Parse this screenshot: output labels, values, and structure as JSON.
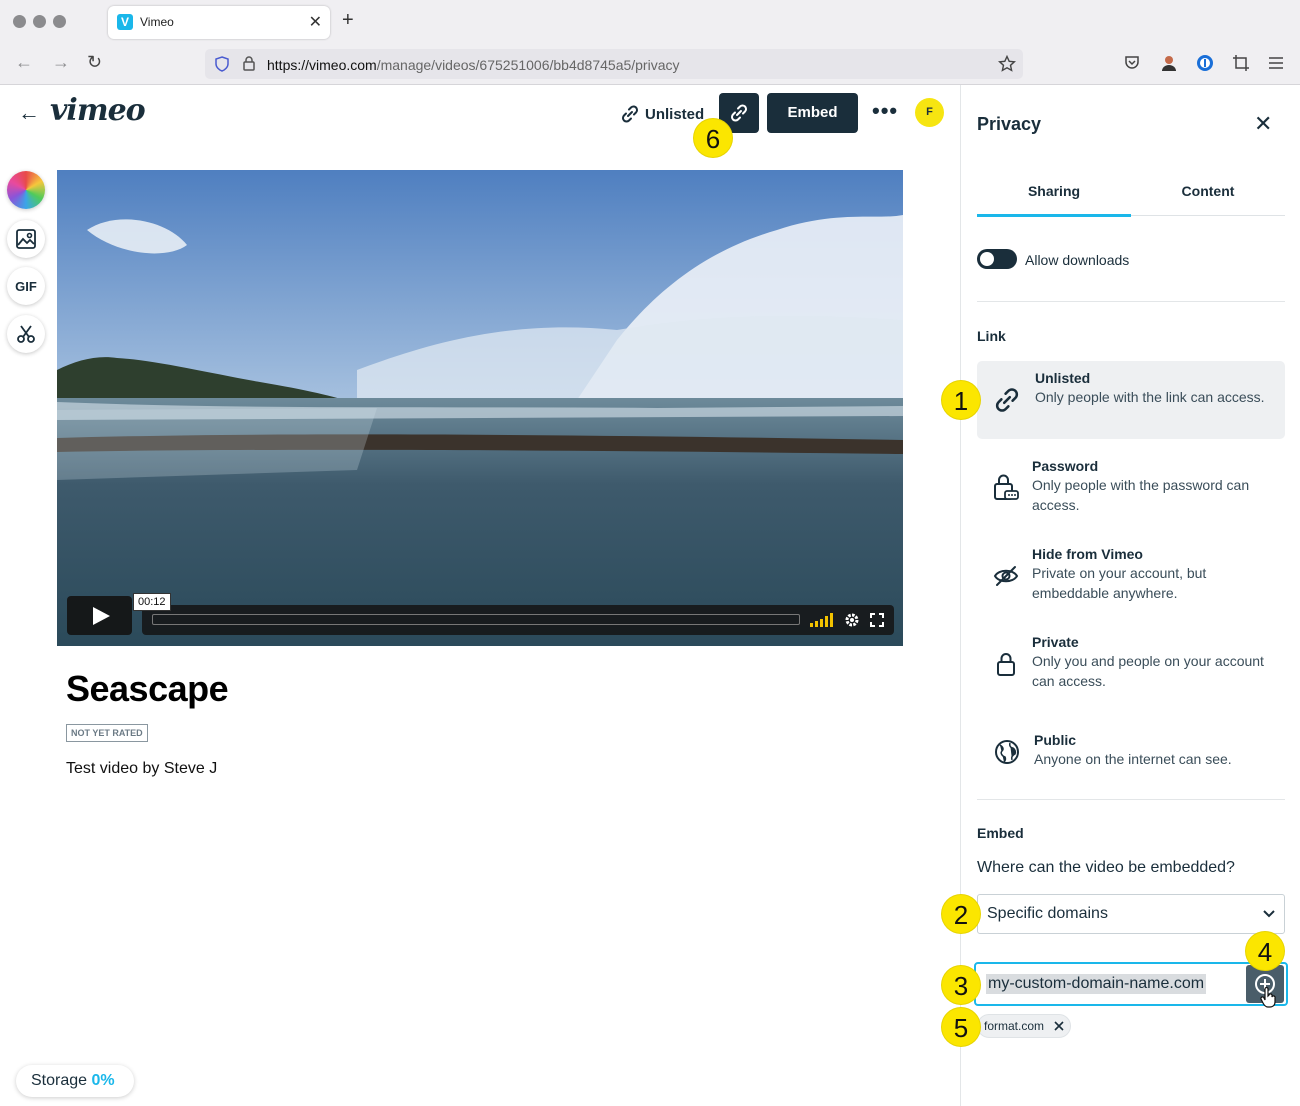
{
  "browser": {
    "tab_title": "Vimeo",
    "tab_favicon": "V",
    "url_host": "https://vimeo.com",
    "url_path": "/manage/videos/675251006/bb4d8745a5/privacy",
    "icons": [
      "back-icon",
      "forward-icon",
      "reload-icon",
      "shield-icon",
      "lock-icon",
      "star-icon",
      "pocket-icon",
      "profile-icon",
      "password-manager-icon",
      "screenshot-icon",
      "menu-icon"
    ]
  },
  "header": {
    "logo": "vimeo",
    "status_label": "Unlisted",
    "embed_label": "Embed",
    "more_label": "•••",
    "avatar_initial": "F"
  },
  "tools": {
    "gif_label": "GIF"
  },
  "video": {
    "time": "00:12",
    "title": "Seascape",
    "rating": "NOT YET RATED",
    "description": "Test video by Steve J"
  },
  "storage": {
    "label": "Storage",
    "percent": "0%"
  },
  "panel": {
    "title": "Privacy",
    "tabs": [
      "Sharing",
      "Content"
    ],
    "allow_downloads": "Allow downloads",
    "link_section": "Link",
    "options": [
      {
        "title": "Unlisted",
        "desc": "Only people with the link can access."
      },
      {
        "title": "Password",
        "desc": "Only people with the password can access."
      },
      {
        "title": "Hide from Vimeo",
        "desc": "Private on your account, but embeddable anywhere."
      },
      {
        "title": "Private",
        "desc": "Only you and people on your account can access."
      },
      {
        "title": "Public",
        "desc": "Anyone on the internet can see."
      }
    ],
    "embed_section": "Embed",
    "embed_question": "Where can the video be embedded?",
    "embed_select": "Specific domains",
    "domain_input": "my-custom-domain-name.com",
    "domain_chip": "format.com"
  },
  "markers": [
    "1",
    "2",
    "3",
    "4",
    "5",
    "6"
  ],
  "colors": {
    "dark": "#1a2e3b",
    "accent": "#1ab7ea",
    "marker": "#fbe600"
  }
}
